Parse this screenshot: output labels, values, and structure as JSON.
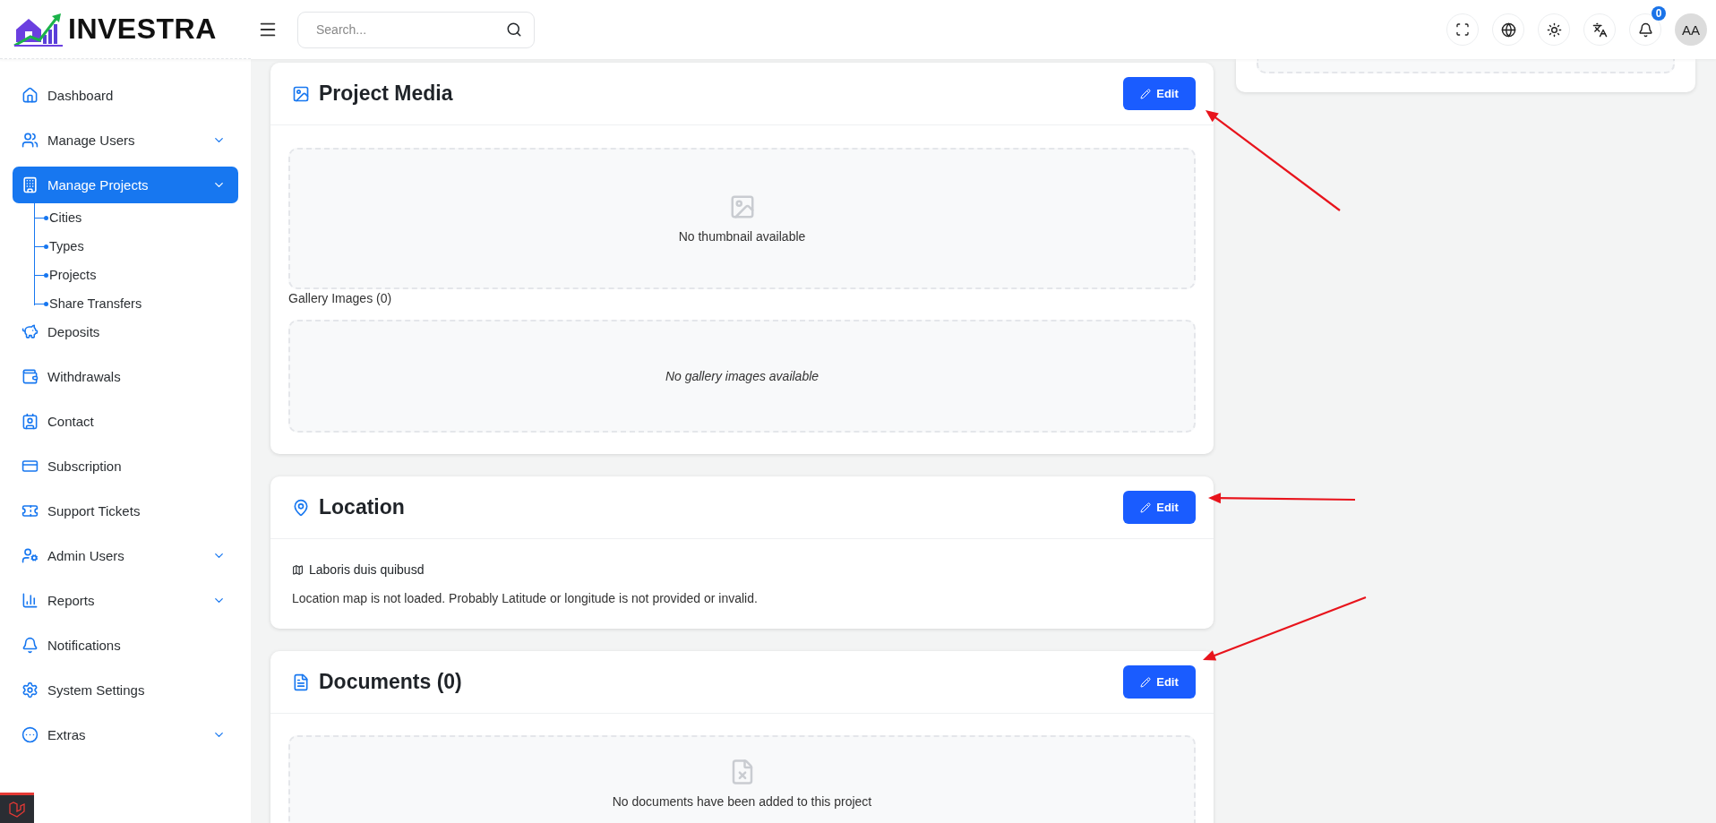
{
  "brand": {
    "name": "INVESTRA"
  },
  "search": {
    "placeholder": "Search..."
  },
  "topbar": {
    "notification_count": "0",
    "avatar": "AA"
  },
  "sidebar": {
    "items": [
      {
        "label": "Dashboard",
        "kind": "link",
        "selected": false
      },
      {
        "label": "Manage Users",
        "kind": "group",
        "selected": false
      },
      {
        "label": "Manage Projects",
        "kind": "group",
        "selected": true,
        "expanded": true,
        "children": [
          {
            "label": "Cities"
          },
          {
            "label": "Types"
          },
          {
            "label": "Projects"
          },
          {
            "label": "Share Transfers"
          }
        ]
      },
      {
        "label": "Deposits",
        "kind": "link",
        "selected": false
      },
      {
        "label": "Withdrawals",
        "kind": "link",
        "selected": false
      },
      {
        "label": "Contact",
        "kind": "link",
        "selected": false
      },
      {
        "label": "Subscription",
        "kind": "link",
        "selected": false
      },
      {
        "label": "Support Tickets",
        "kind": "link",
        "selected": false
      },
      {
        "label": "Admin Users",
        "kind": "group",
        "selected": false
      },
      {
        "label": "Reports",
        "kind": "group",
        "selected": false
      },
      {
        "label": "Notifications",
        "kind": "link",
        "selected": false
      },
      {
        "label": "System Settings",
        "kind": "link",
        "selected": false
      },
      {
        "label": "Extras",
        "kind": "group",
        "selected": false
      }
    ]
  },
  "cards": [
    {
      "kind": "media",
      "title": "Project Media",
      "edit": "Edit",
      "thumbnail_empty": "No thumbnail available",
      "gallery_label": "Gallery Images (0)",
      "gallery_empty": "No gallery images available"
    },
    {
      "kind": "location",
      "title": "Location",
      "edit": "Edit",
      "address": "Laboris duis quibusd",
      "message": "Location map is not loaded. Probably Latitude or longitude is not provided or invalid."
    },
    {
      "kind": "documents",
      "title": "Documents (0)",
      "edit": "Edit",
      "empty": "No documents have been added to this project"
    }
  ]
}
